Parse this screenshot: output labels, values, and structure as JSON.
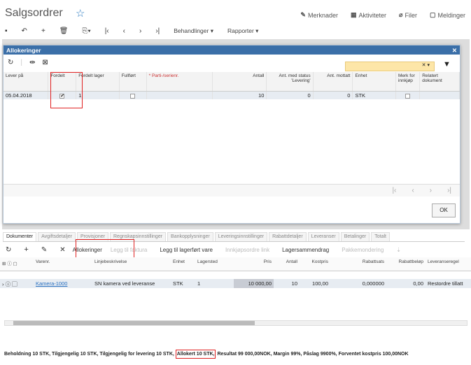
{
  "page": {
    "title": "Salgsordrer",
    "favorite_icon": "star-icon"
  },
  "header_links": [
    {
      "icon": "note-icon",
      "label": "Merknader"
    },
    {
      "icon": "calendar-icon",
      "label": "Aktiviteter"
    },
    {
      "icon": "paperclip-icon",
      "label": "Filer"
    },
    {
      "icon": "message-icon",
      "label": "Meldinger"
    }
  ],
  "toolbar": {
    "behandlinger": "Behandlinger",
    "rapporter": "Rapporter"
  },
  "modal": {
    "title": "Allokeringer",
    "search_value": "",
    "columns": [
      "Lever på",
      "Fordelt",
      "Fordelt lager",
      "Fullført",
      "* Parti-/serienr.",
      "Antall",
      "Ant. med status 'Levering'",
      "Ant. mottatt",
      "Enhet",
      "Merk for innkjøp",
      "Relatert dokument"
    ],
    "rows": [
      {
        "lever_pa": "05.04.2018",
        "fordelt": "✔",
        "fordelt_lager": "1",
        "fullfort": "",
        "parti": "",
        "antall": "10",
        "ant_status": "0",
        "ant_mottatt": "0",
        "enhet": "STK",
        "merk": "",
        "relatert": ""
      }
    ],
    "ok_label": "OK"
  },
  "tabs": [
    "Dokumenter",
    "Avgiftsdetaljer",
    "Provisjoner",
    "Regnskapsinnstillinger",
    "Bankopplysninger",
    "Leveringsinnstillinger",
    "Rabattdetaljer",
    "Leveranser",
    "Betalinger",
    "Totalt"
  ],
  "lines_toolbar": {
    "allokeringer": "Allokeringer",
    "legg_til_faktura": "Legg til faktura",
    "legg_til_lagerfort": "Legg til lagerført vare",
    "innkjopsordre": "Innkjøpsordre link",
    "lagersammendrag": "Lagersammendrag",
    "pakkemondering": "Pakkemondering"
  },
  "lines_columns": [
    "Varenr.",
    "Linjebeskrivelse",
    "Enhet",
    "Lagersted",
    "Pris",
    "Antall",
    "Kostpris",
    "Rabattsats",
    "Rabattbeløp",
    "Leveranseregel"
  ],
  "lines_rows": [
    {
      "varenr": "Kamera-1000",
      "beskrivelse": "SN kamera ved leveranse",
      "enhet": "STK",
      "lager": "1",
      "pris": "10 000,00",
      "antall": "10",
      "kostpris": "100,00",
      "rabattsats": "0,000000",
      "rabattbelop": "0,00",
      "regel": "Restordre tillatt"
    }
  ],
  "status_bar": {
    "part1": "Beholdning 10 STK, Tilgjengelig 10 STK, Tilgjengelig for levering 10 STK,",
    "part2": "Allokert 10 STK,",
    "part3": "Resultat 99 000,00NOK, Margin 99%, Påslag 9900%, Forventet kostpris 100,00NOK"
  }
}
